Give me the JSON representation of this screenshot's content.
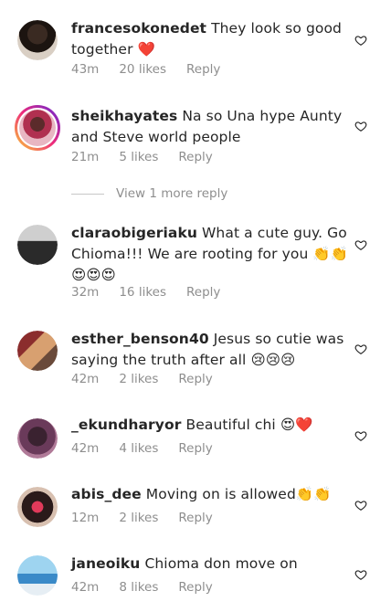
{
  "comments": [
    {
      "username": "francesokonedet",
      "text": "They look so good together ❤️",
      "time": "43m",
      "likes": "20 likes",
      "reply": "Reply"
    },
    {
      "username": "sheikhayates",
      "text": "Na so Una hype Aunty and Steve world people",
      "time": "21m",
      "likes": "5 likes",
      "reply": "Reply"
    },
    {
      "username": "claraobigeriaku",
      "text": "What a cute guy. Go Chioma!!! We are rooting for you 👏👏 😍😍😍",
      "time": "32m",
      "likes": "16 likes",
      "reply": "Reply"
    },
    {
      "username": "esther_benson40",
      "text": "Jesus so cutie was saying the truth after all 😢😢😢",
      "time": "42m",
      "likes": "2 likes",
      "reply": "Reply"
    },
    {
      "username": "_ekundharyor",
      "text": "Beautiful chi 😍❤️",
      "time": "42m",
      "likes": "4 likes",
      "reply": "Reply"
    },
    {
      "username": "abis_dee",
      "text": "Moving  on is allowed👏👏",
      "time": "12m",
      "likes": "2 likes",
      "reply": "Reply"
    },
    {
      "username": "janeoiku",
      "text": "Chioma don move on",
      "time": "42m",
      "likes": "8 likes",
      "reply": "Reply"
    }
  ],
  "view_more": "View 1 more reply",
  "icons": {
    "like": "heart-outline-icon"
  },
  "colors": {
    "text": "#262626",
    "muted": "#8e8e8e",
    "story_ring": "#d6249f"
  }
}
